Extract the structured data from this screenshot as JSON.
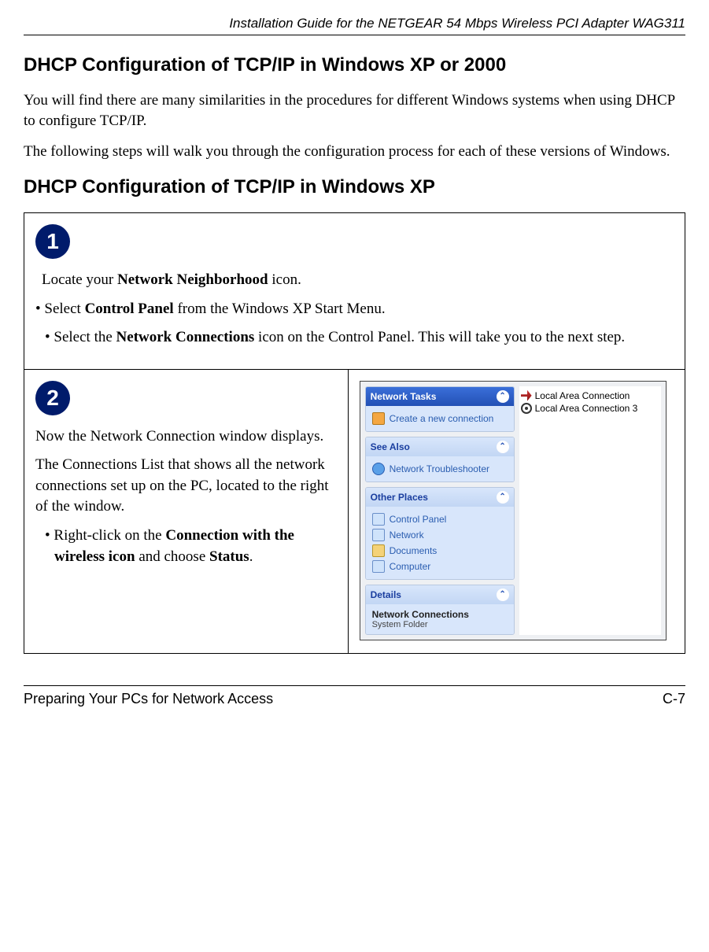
{
  "header": {
    "doc_title": "Installation Guide for the NETGEAR 54 Mbps Wireless PCI Adapter WAG311"
  },
  "h2_a": "DHCP Configuration of TCP/IP in Windows XP or 2000",
  "para_a": "You will find there are many similarities in the procedures for different Windows systems when using DHCP to configure TCP/IP.",
  "para_b": "The following steps will walk you through the configuration process for each of these versions of Windows.",
  "h2_b": "DHCP Configuration of TCP/IP in Windows XP",
  "step1": {
    "num": "1",
    "line1_pre": "Locate your ",
    "line1_bold": "Network Neighborhood",
    "line1_post": " icon.",
    "b1_pre": "• Select ",
    "b1_bold": "Control Panel",
    "b1_post": " from the Windows XP Start Menu.",
    "b2_pre": "• Select the ",
    "b2_bold": "Network Connections",
    "b2_post": " icon on the Control Panel.  This will take you to the next step."
  },
  "step2": {
    "num": "2",
    "p1": "Now the Network Connection window displays.",
    "p2": "The Connections List that shows all the network connections set up on the PC, located to the right of the window.",
    "b1_pre": "• Right-click on the ",
    "b1_bold": "Connection with the wireless icon",
    "b1_mid": " and choose ",
    "b1_bold2": "Status",
    "b1_post": "."
  },
  "xp": {
    "tasks_header": "Network Tasks",
    "tasks_item": "Create a new connection",
    "see_also_header": "See Also",
    "see_also_item": "Network Troubleshooter",
    "other_header": "Other Places",
    "other_items": [
      "Control Panel",
      "Network",
      "Documents",
      "Computer"
    ],
    "details_header": "Details",
    "details_title": "Network Connections",
    "details_sub": "System Folder",
    "conn1": "Local Area Connection",
    "conn2": "Local Area Connection 3"
  },
  "footer": {
    "left": "Preparing Your PCs for Network Access",
    "right": "C-7"
  }
}
